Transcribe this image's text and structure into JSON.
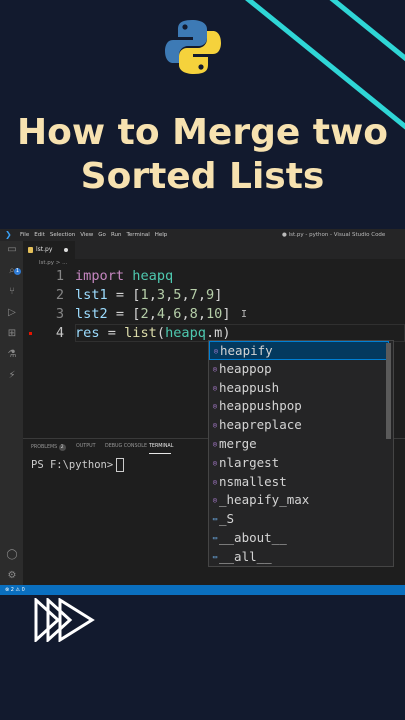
{
  "banner": {
    "title_line1": "How to Merge two",
    "title_line2": "Sorted Lists",
    "colors": {
      "background": "#121a2e",
      "title": "#f7e2b0",
      "accent": "#2fd6d6"
    }
  },
  "vscode": {
    "menu": [
      "File",
      "Edit",
      "Selection",
      "View",
      "Go",
      "Run",
      "Terminal",
      "Help"
    ],
    "window_title": "● lst.py - python - Visual Studio Code",
    "tab_label": "lst.py",
    "breadcrumb": "lst.py > ...",
    "activity_badge": "1",
    "lines": [
      {
        "num": "1",
        "segments": [
          {
            "t": "import",
            "c": "kw"
          },
          {
            "t": " ",
            "c": ""
          },
          {
            "t": "heapq",
            "c": "mod"
          }
        ]
      },
      {
        "num": "2",
        "segments": [
          {
            "t": "lst1",
            "c": "var"
          },
          {
            "t": " = [",
            "c": ""
          },
          {
            "t": "1",
            "c": "num"
          },
          {
            "t": ",",
            "c": ""
          },
          {
            "t": "3",
            "c": "num"
          },
          {
            "t": ",",
            "c": ""
          },
          {
            "t": "5",
            "c": "num"
          },
          {
            "t": ",",
            "c": ""
          },
          {
            "t": "7",
            "c": "num"
          },
          {
            "t": ",",
            "c": ""
          },
          {
            "t": "9",
            "c": "num"
          },
          {
            "t": "]",
            "c": ""
          }
        ]
      },
      {
        "num": "3",
        "segments": [
          {
            "t": "lst2",
            "c": "var"
          },
          {
            "t": " = [",
            "c": ""
          },
          {
            "t": "2",
            "c": "num"
          },
          {
            "t": ",",
            "c": ""
          },
          {
            "t": "4",
            "c": "num"
          },
          {
            "t": ",",
            "c": ""
          },
          {
            "t": "6",
            "c": "num"
          },
          {
            "t": ",",
            "c": ""
          },
          {
            "t": "8",
            "c": "num"
          },
          {
            "t": ",",
            "c": ""
          },
          {
            "t": "10",
            "c": "num"
          },
          {
            "t": "]",
            "c": ""
          }
        ]
      },
      {
        "num": "4",
        "segments": [
          {
            "t": "res",
            "c": "var"
          },
          {
            "t": " = ",
            "c": ""
          },
          {
            "t": "list",
            "c": "fn"
          },
          {
            "t": "(",
            "c": ""
          },
          {
            "t": "heapq",
            "c": "mod"
          },
          {
            "t": ".m)",
            "c": ""
          }
        ]
      }
    ],
    "panel_tabs": {
      "problems": "PROBLEMS",
      "problems_count": "2",
      "output": "OUTPUT",
      "debug": "DEBUG CONSOLE",
      "terminal": "TERMINAL"
    },
    "terminal_prompt": "PS F:\\python>",
    "suggestions": [
      {
        "label": "heapify",
        "kind": "method"
      },
      {
        "label": "heappop",
        "kind": "method"
      },
      {
        "label": "heappush",
        "kind": "method"
      },
      {
        "label": "heappushpop",
        "kind": "method"
      },
      {
        "label": "heapreplace",
        "kind": "method"
      },
      {
        "label": "merge",
        "kind": "method"
      },
      {
        "label": "nlargest",
        "kind": "method"
      },
      {
        "label": "nsmallest",
        "kind": "method"
      },
      {
        "label": "_heapify_max",
        "kind": "method"
      },
      {
        "label": "_S",
        "kind": "variable"
      },
      {
        "label": "__about__",
        "kind": "variable"
      },
      {
        "label": "__all__",
        "kind": "variable"
      }
    ],
    "selected_suggestion": "heapify",
    "status_text": "⊗ 2 ⚠ 0"
  }
}
